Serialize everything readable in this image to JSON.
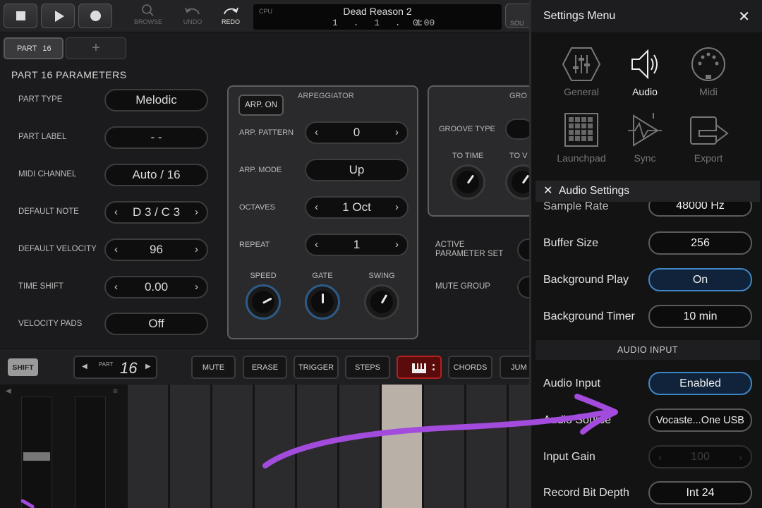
{
  "topbar": {
    "browse_label": "BROWSE",
    "undo_label": "UNDO",
    "redo_label": "REDO",
    "cpu_label": "CPU",
    "song_name": "Dead Reason 2",
    "position": "1 . 1 . 1",
    "time": "0:00",
    "sound_label": "SOU"
  },
  "part_tabs": {
    "active_prefix": "PART",
    "active_number": "16",
    "add_symbol": "+"
  },
  "params": {
    "title": "PART 16  PARAMETERS",
    "rows": [
      {
        "label": "PART TYPE",
        "value": "Melodic"
      },
      {
        "label": "PART LABEL",
        "value": "- -"
      },
      {
        "label": "MIDI CHANNEL",
        "value": "Auto / 16"
      },
      {
        "label": "DEFAULT NOTE",
        "value": "D 3 / C 3"
      },
      {
        "label": "DEFAULT VELOCITY",
        "value": "96"
      },
      {
        "label": "TIME SHIFT",
        "value": "0.00"
      },
      {
        "label": "VELOCITY PADS",
        "value": "Off"
      }
    ]
  },
  "arp": {
    "title": "ARPEGGIATOR",
    "on_label": "ARP. ON",
    "rows": [
      {
        "label": "ARP. PATTERN",
        "value": "0"
      },
      {
        "label": "ARP. MODE",
        "value": "Up"
      },
      {
        "label": "OCTAVES",
        "value": "1 Oct"
      },
      {
        "label": "REPEAT",
        "value": "1"
      }
    ],
    "knobs": [
      {
        "label": "SPEED"
      },
      {
        "label": "GATE"
      },
      {
        "label": "SWING"
      }
    ]
  },
  "groove": {
    "title": "GRO",
    "type_label": "GROOVE TYPE",
    "to_time": "TO TIME",
    "to_v": "TO V",
    "active_set_line1": "ACTIVE",
    "active_set_line2": "PARAMETER SET",
    "mute_group": "MUTE GROUP"
  },
  "lower_toolbar": {
    "shift": "SHIFT",
    "part_label": "PART",
    "part_number": "16",
    "buttons": [
      "MUTE",
      "ERASE",
      "TRIGGER",
      "STEPS"
    ],
    "chords": "CHORDS",
    "jump": "JUM"
  },
  "settings": {
    "title": "Settings Menu",
    "close": "✕",
    "categories": [
      "General",
      "Audio",
      "Midi",
      "Launchpad",
      "Sync",
      "Export"
    ],
    "sub_title": "Audio Settings",
    "sub_close": "✕",
    "sample_rate_label": "Sample Rate",
    "sample_rate_value": "48000 Hz",
    "rows": [
      {
        "label": "Buffer Size",
        "value": "256"
      },
      {
        "label": "Background Play",
        "value": "On"
      },
      {
        "label": "Background Timer",
        "value": "10 min"
      }
    ],
    "section": "AUDIO INPUT",
    "input_rows": [
      {
        "label": "Audio Input",
        "value": "Enabled"
      },
      {
        "label": "Audio Source",
        "value": "Vocaste...One USB"
      },
      {
        "label": "Input Gain",
        "value": "100"
      },
      {
        "label": "Record Bit Depth",
        "value": "Int 24"
      }
    ]
  },
  "colors": {
    "accent_blue": "#3f86c7",
    "annotation_purple": "#a24bdc",
    "piano_red": "#b32020"
  },
  "icons": [
    "stop-icon",
    "play-icon",
    "record-icon",
    "browse-icon",
    "undo-icon",
    "redo-icon",
    "close-icon",
    "mixer-icon",
    "speaker-icon",
    "midi-din-icon",
    "launchpad-grid-icon",
    "sync-icon",
    "export-icon",
    "piano-keys-icon",
    "menu-icon"
  ]
}
